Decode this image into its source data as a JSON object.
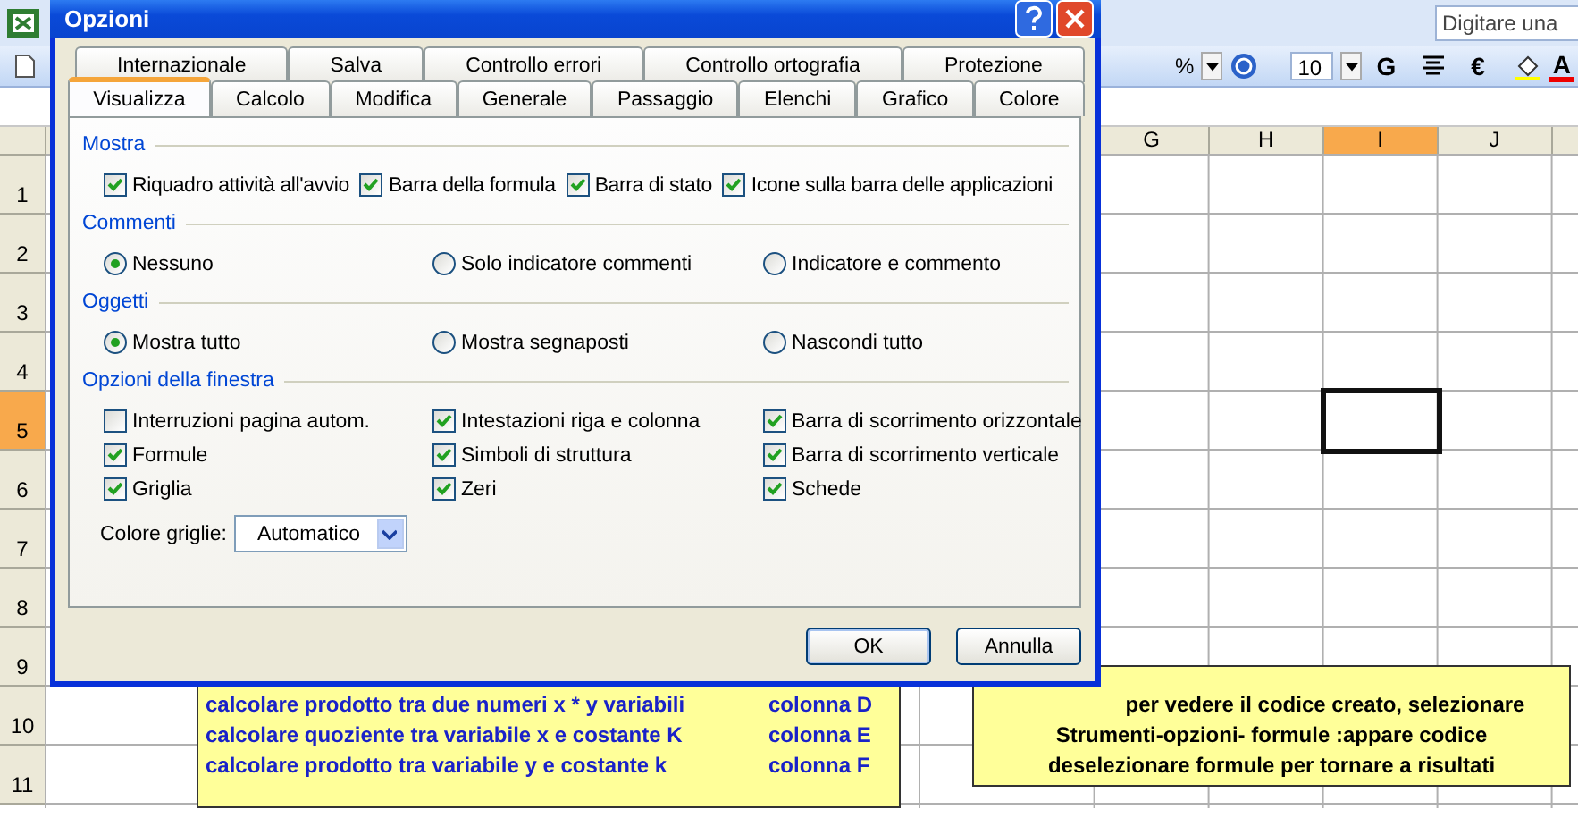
{
  "toolbar": {
    "percent": "%",
    "font_size": "10",
    "bold_button": "G",
    "currency_button": "€",
    "font_color_button": "A"
  },
  "help_search": {
    "placeholder": "Digitare una"
  },
  "sheet": {
    "columns": [
      {
        "label": "G",
        "selected": false
      },
      {
        "label": "H",
        "selected": false
      },
      {
        "label": "I",
        "selected": true
      },
      {
        "label": "J",
        "selected": false
      }
    ],
    "rows": [
      {
        "label": "1",
        "selected": false
      },
      {
        "label": "2",
        "selected": false
      },
      {
        "label": "3",
        "selected": false
      },
      {
        "label": "4",
        "selected": false
      },
      {
        "label": "5",
        "selected": true
      },
      {
        "label": "6",
        "selected": false
      },
      {
        "label": "7",
        "selected": false
      },
      {
        "label": "8",
        "selected": false
      },
      {
        "label": "9",
        "selected": false
      },
      {
        "label": "10",
        "selected": false
      },
      {
        "label": "11",
        "selected": false
      }
    ],
    "text_boxes": [
      {
        "kind": "list",
        "lines": [
          {
            "text": "calcolare prodotto tra due numeri x * y variabili",
            "column": "colonna D"
          },
          {
            "text": "calcolare quoziente tra variabile x e costante K",
            "column": "colonna E"
          },
          {
            "text": "calcolare prodotto tra variabile  y e costante k",
            "column": "colonna F"
          }
        ]
      },
      {
        "kind": "note",
        "lines": [
          "per vedere il codice creato, selezionare",
          "Strumenti-opzioni- formule :appare codice",
          "deselezionare formule per tornare a risultati"
        ]
      }
    ]
  },
  "dialog": {
    "title": "Opzioni",
    "tab_rows": [
      [
        {
          "label": "Internazionale",
          "selected": false
        },
        {
          "label": "Salva",
          "selected": false
        },
        {
          "label": "Controllo errori",
          "selected": false
        },
        {
          "label": "Controllo ortografia",
          "selected": false
        },
        {
          "label": "Protezione",
          "selected": false
        }
      ],
      [
        {
          "label": "Visualizza",
          "selected": true
        },
        {
          "label": "Calcolo",
          "selected": false
        },
        {
          "label": "Modifica",
          "selected": false
        },
        {
          "label": "Generale",
          "selected": false
        },
        {
          "label": "Passaggio",
          "selected": false
        },
        {
          "label": "Elenchi",
          "selected": false
        },
        {
          "label": "Grafico",
          "selected": false
        },
        {
          "label": "Colore",
          "selected": false
        }
      ]
    ],
    "sections": [
      {
        "heading": "Mostra",
        "options": [
          {
            "kind": "checkbox",
            "label": "Riquadro attività all'avvio",
            "checked": true
          },
          {
            "kind": "checkbox",
            "label": "Barra della formula",
            "checked": true
          },
          {
            "kind": "checkbox",
            "label": "Barra di stato",
            "checked": true
          },
          {
            "kind": "checkbox",
            "label": "Icone sulla barra delle applicazioni",
            "checked": true
          }
        ]
      },
      {
        "heading": "Commenti",
        "options": [
          {
            "kind": "radio",
            "label": "Nessuno",
            "selected": true
          },
          {
            "kind": "radio",
            "label": "Solo indicatore commenti",
            "selected": false
          },
          {
            "kind": "radio",
            "label": "Indicatore e commento",
            "selected": false
          }
        ]
      },
      {
        "heading": "Oggetti",
        "options": [
          {
            "kind": "radio",
            "label": "Mostra tutto",
            "selected": true
          },
          {
            "kind": "radio",
            "label": "Mostra segnaposti",
            "selected": false
          },
          {
            "kind": "radio",
            "label": "Nascondi tutto",
            "selected": false
          }
        ]
      },
      {
        "heading": "Opzioni della finestra",
        "options": [
          {
            "kind": "checkbox",
            "label": "Interruzioni pagina autom.",
            "checked": false
          },
          {
            "kind": "checkbox",
            "label": "Intestazioni riga e colonna",
            "checked": true
          },
          {
            "kind": "checkbox",
            "label": "Barra di scorrimento orizzontale",
            "checked": true
          },
          {
            "kind": "checkbox",
            "label": "Formule",
            "checked": true
          },
          {
            "kind": "checkbox",
            "label": "Simboli di struttura",
            "checked": true
          },
          {
            "kind": "checkbox",
            "label": "Barra di scorrimento verticale",
            "checked": true
          },
          {
            "kind": "checkbox",
            "label": "Griglia",
            "checked": true
          },
          {
            "kind": "checkbox",
            "label": "Zeri",
            "checked": true
          },
          {
            "kind": "checkbox",
            "label": "Schede",
            "checked": true
          }
        ]
      }
    ],
    "grid_color": {
      "label": "Colore griglie:",
      "value": "Automatico"
    },
    "buttons": [
      "OK",
      "Annulla"
    ]
  }
}
